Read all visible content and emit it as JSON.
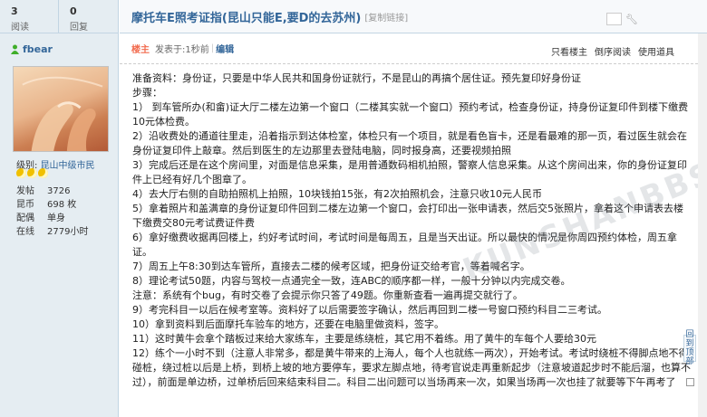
{
  "stats": [
    {
      "num": "3",
      "label": "阅读"
    },
    {
      "num": "0",
      "label": "回复"
    }
  ],
  "author": {
    "name": "fbear",
    "level_label": "级别:",
    "level": "昆山中级市民",
    "info": [
      {
        "k": "发帖",
        "v": "3726"
      },
      {
        "k": "昆币",
        "v": "698 枚"
      },
      {
        "k": "配偶",
        "v": "单身"
      },
      {
        "k": "在线",
        "v": "2779小时"
      }
    ]
  },
  "thread": {
    "title": "摩托车E照考证指(昆山只能E,要D的去苏州)",
    "copy_link": "[复制链接]"
  },
  "post": {
    "badge": "楼主",
    "posted_prefix": "发表于: ",
    "posted_time": "1秒前",
    "edit": "编辑",
    "actions": [
      "只看楼主",
      "倒序阅读",
      "使用道具"
    ]
  },
  "content": [
    "准备资料：身份证，只要是中华人民共和国身份证就行，不是昆山的再搞个居住证。预先复印好身份证",
    "步骤：",
    "1） 到车管所办(和畲)证大厅二楼左边第一个窗口（二楼其实就一个窗口）预约考试，检查身份证，持身份证复印件到楼下缴费10元体检费。",
    "2）沿收费处的通道往里走，沿着指示到达体检室，体检只有一个项目，就是看色盲卡，还是看最难的那一页，看过医生就会在身份证复印件上敲章。然后到医生的左边那里去登陆电脑，同时报身高，还要视频拍照",
    "3）完成后还是在这个房间里，对面是信息采集，是用普通数码相机拍照，警察人信息采集。从这个房间出来，你的身份证复印件上已经有好几个图章了。",
    "4）去大厅右侧的自助拍照机上拍照，10块钱拍15张，有2次拍照机会，注意只收10元人民币",
    "5）拿着照片和盖满章的身份证复印件回到二楼左边第一个窗口，会打印出一张申请表，然后交5张照片，拿着这个申请表去楼下缴费交80元考试费证件费",
    "6）拿好缴费收据再回楼上，约好考试时间，考试时间是每周五，且是当天出证。所以最快的情况是你周四预约体检，周五拿证。",
    "7）周五上午8:30到达车管所，直接去二楼的候考区域，把身份证交给考官，等着喊名字。",
    "8）理论考试50题，内容与驾校一点通完全一致，连ABC的顺序都一样，一般十分钟以内完成交卷。",
    "注意：系统有个bug，有时交卷了会提示你只答了49题。你重新查看一遍再提交就行了。",
    "9）考完科目一以后在候考室等。资料好了以后需要签字确认，然后再回到二楼一号窗口预约科目二三考试。",
    "10）拿到资料到后面摩托车验车的地方，还要在电脑里做资料，签字。",
    "11）这时黄牛会拿个踏板过来给大家练车，主要是练绕桩，其它用不着练。用了黄牛的车每个人要给30元",
    "12）练个一小时不到（注意人非常多，都是黄牛带来的上海人，每个人也就练一两次），开始考试。考试时绕桩不得脚点地不得碰桩，绕过桩以后是上桥，到桥上坡的地方要停车，要求左脚点地，待考官说走再重新起步（注意坡道起步时不能后溜，也算不过），前面是单边桥，过单桥后回来结束科目二。科目二出问题可以当场再来一次，如果当场再一次也挂了就要等下午再考了"
  ],
  "watermark": "KUNSHANBBS",
  "back_top": "回到顶部"
}
